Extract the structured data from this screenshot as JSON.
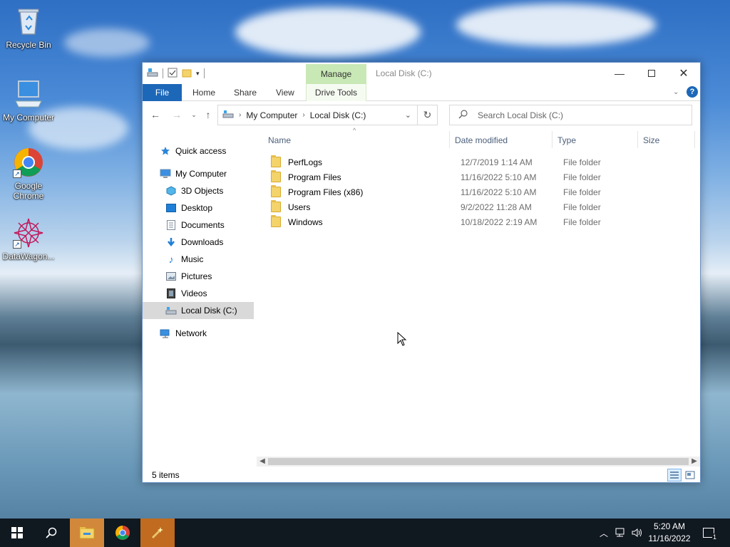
{
  "desktop": {
    "icons": [
      {
        "label": "Recycle Bin",
        "icon": "recycle-bin-icon"
      },
      {
        "label": "My Computer",
        "icon": "computer-icon"
      },
      {
        "label": "Google Chrome",
        "icon": "chrome-icon"
      },
      {
        "label": "DataWagon...",
        "icon": "datawagon-icon"
      }
    ]
  },
  "window": {
    "title": "Local Disk (C:)",
    "manage_tab": "Manage",
    "ribbon_tabs": {
      "file": "File",
      "home": "Home",
      "share": "Share",
      "view": "View",
      "drive_tools": "Drive Tools"
    },
    "address": {
      "crumbs": [
        "My Computer",
        "Local Disk (C:)"
      ]
    },
    "search": {
      "placeholder": "Search Local Disk (C:)"
    },
    "nav": {
      "quick_access": "Quick access",
      "my_computer": "My Computer",
      "children": [
        "3D Objects",
        "Desktop",
        "Documents",
        "Downloads",
        "Music",
        "Pictures",
        "Videos",
        "Local Disk (C:)"
      ],
      "network": "Network",
      "selected": "Local Disk (C:)"
    },
    "columns": {
      "name": "Name",
      "date": "Date modified",
      "type": "Type",
      "size": "Size"
    },
    "files": [
      {
        "name": "PerfLogs",
        "date": "12/7/2019 1:14 AM",
        "type": "File folder"
      },
      {
        "name": "Program Files",
        "date": "11/16/2022 5:10 AM",
        "type": "File folder"
      },
      {
        "name": "Program Files (x86)",
        "date": "11/16/2022 5:10 AM",
        "type": "File folder"
      },
      {
        "name": "Users",
        "date": "9/2/2022 11:28 AM",
        "type": "File folder"
      },
      {
        "name": "Windows",
        "date": "10/18/2022 2:19 AM",
        "type": "File folder"
      }
    ],
    "status": "5 items"
  },
  "taskbar": {
    "time": "5:20 AM",
    "date": "11/16/2022",
    "notification_count": "1"
  },
  "colors": {
    "accent": "#1d67b8",
    "manage": "#c8e8b5",
    "taskbar": "#101820"
  }
}
